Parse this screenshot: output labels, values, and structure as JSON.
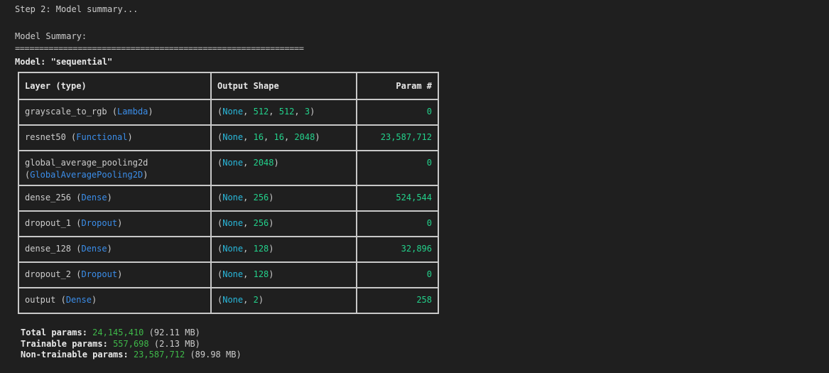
{
  "header": {
    "step": "Step 2: Model summary...",
    "summary_label": "Model Summary:",
    "separator": "============================================================",
    "model_label": "Model: \"sequential\""
  },
  "table": {
    "columns": [
      "Layer (type)",
      "Output Shape",
      "Param #"
    ],
    "rows": [
      {
        "name": "grayscale_to_rgb",
        "type": "Lambda",
        "shape_none": "None",
        "shape_rest": [
          "512",
          "512",
          "3"
        ],
        "params": "0"
      },
      {
        "name": "resnet50",
        "type": "Functional",
        "shape_none": "None",
        "shape_rest": [
          "16",
          "16",
          "2048"
        ],
        "params": "23,587,712"
      },
      {
        "name": "global_average_pooling2d",
        "type": "GlobalAveragePooling2D",
        "shape_none": "None",
        "shape_rest": [
          "2048"
        ],
        "params": "0"
      },
      {
        "name": "dense_256",
        "type": "Dense",
        "shape_none": "None",
        "shape_rest": [
          "256"
        ],
        "params": "524,544"
      },
      {
        "name": "dropout_1",
        "type": "Dropout",
        "shape_none": "None",
        "shape_rest": [
          "256"
        ],
        "params": "0"
      },
      {
        "name": "dense_128",
        "type": "Dense",
        "shape_none": "None",
        "shape_rest": [
          "128"
        ],
        "params": "32,896"
      },
      {
        "name": "dropout_2",
        "type": "Dropout",
        "shape_none": "None",
        "shape_rest": [
          "128"
        ],
        "params": "0"
      },
      {
        "name": "output",
        "type": "Dense",
        "shape_none": "None",
        "shape_rest": [
          "2"
        ],
        "params": "258"
      }
    ]
  },
  "totals": {
    "total_label": "Total params:",
    "total_value": "24,145,410",
    "total_size": "(92.11 MB)",
    "trainable_label": "Trainable params:",
    "trainable_value": "557,698",
    "trainable_size": "(2.13 MB)",
    "nontrainable_label": "Non-trainable params:",
    "nontrainable_value": "23,587,712",
    "nontrainable_size": "(89.98 MB)"
  },
  "colors": {
    "background": "#1f1f1f",
    "text": "#cccccc",
    "class_name": "#3b8eea",
    "none_keyword": "#29b8db",
    "number": "#23d18b",
    "border": "#c8c8c8"
  }
}
